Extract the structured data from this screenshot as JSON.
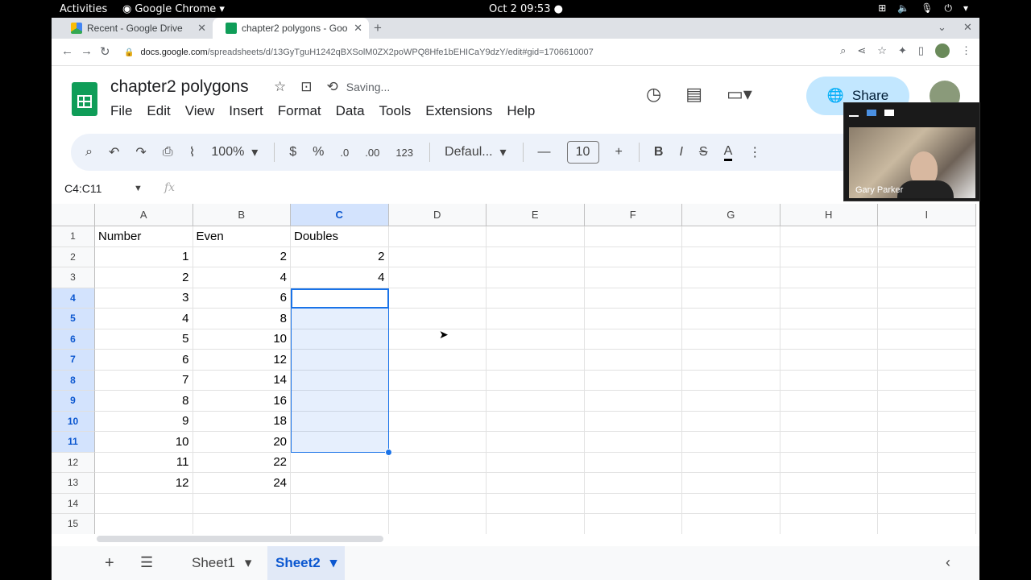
{
  "os": {
    "activities": "Activities",
    "app_name": "Google Chrome",
    "clock": "Oct 2  09:53"
  },
  "tabs": [
    {
      "title": "Recent - Google Drive",
      "active": false
    },
    {
      "title": "chapter2 polygons - Goo",
      "active": true
    }
  ],
  "omnibox": {
    "domain": "docs.google.com",
    "path": "/spreadsheets/d/13GyTguH1242qBXSolM0ZX2poWPQ8Hfe1bEHICaY9dzY/edit#gid=1706610007"
  },
  "doc": {
    "title": "chapter2 polygons",
    "status": "Saving..."
  },
  "menu": [
    "File",
    "Edit",
    "View",
    "Insert",
    "Format",
    "Data",
    "Tools",
    "Extensions",
    "Help"
  ],
  "share_label": "Share",
  "toolbar": {
    "zoom": "100%",
    "currency": "$",
    "percent": "%",
    "dec_decrease": ".0",
    "dec_increase": ".00",
    "number_format": "123",
    "font": "Defaul...",
    "font_size": "10",
    "bold": "B",
    "italic": "I",
    "strike": "S",
    "text_color": "A"
  },
  "formula_bar": {
    "name_box": "C4:C11",
    "fx": "fx"
  },
  "columns": [
    "A",
    "B",
    "C",
    "D",
    "E",
    "F",
    "G",
    "H",
    "I"
  ],
  "rows": [
    "1",
    "2",
    "3",
    "4",
    "5",
    "6",
    "7",
    "8",
    "9",
    "10",
    "11",
    "12",
    "13",
    "14",
    "15"
  ],
  "cells": {
    "A": [
      "Number",
      "1",
      "2",
      "3",
      "4",
      "5",
      "6",
      "7",
      "8",
      "9",
      "10",
      "11",
      "12",
      "",
      ""
    ],
    "B": [
      "Even",
      "2",
      "4",
      "6",
      "8",
      "10",
      "12",
      "14",
      "16",
      "18",
      "20",
      "22",
      "24",
      "",
      ""
    ],
    "C": [
      "Doubles",
      "2",
      "4",
      "",
      "",
      "",
      "",
      "",
      "",
      "",
      "",
      "",
      "",
      "",
      ""
    ]
  },
  "selection": "C4:C11",
  "sheets": [
    {
      "name": "Sheet1",
      "active": false
    },
    {
      "name": "Sheet2",
      "active": true
    }
  ],
  "webcam": {
    "name": "Gary Parker"
  },
  "colors": {
    "accent": "#1a73e8",
    "share_bg": "#c2e7ff",
    "toolbar_bg": "#edf2fa",
    "sheets_green": "#0f9d58"
  }
}
